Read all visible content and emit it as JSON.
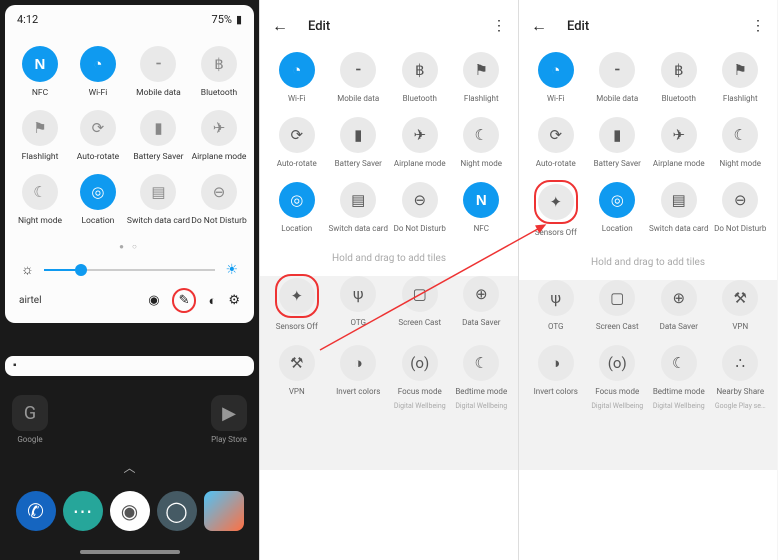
{
  "status": {
    "time": "4:12",
    "battery_pct": "75%"
  },
  "panel1": {
    "tiles": [
      {
        "label": "NFC",
        "icon": "N",
        "on": true
      },
      {
        "label": "Wi-Fi",
        "icon": "wifi",
        "on": true
      },
      {
        "label": "Mobile data",
        "icon": "signal",
        "on": false
      },
      {
        "label": "Bluetooth",
        "icon": "bt",
        "on": false
      },
      {
        "label": "Flashlight",
        "icon": "flash",
        "on": false
      },
      {
        "label": "Auto-rotate",
        "icon": "rotate",
        "on": false
      },
      {
        "label": "Battery Saver",
        "icon": "batt",
        "on": false
      },
      {
        "label": "Airplane mode",
        "icon": "plane",
        "on": false
      },
      {
        "label": "Night mode",
        "icon": "moon",
        "on": false
      },
      {
        "label": "Location",
        "icon": "loc",
        "on": true
      },
      {
        "label": "Switch data card",
        "icon": "sim",
        "on": false
      },
      {
        "label": "Do Not Disturb",
        "icon": "dnd",
        "on": false
      }
    ],
    "carrier": "airtel",
    "apps": {
      "google": "Google",
      "playstore": "Play Store"
    }
  },
  "edit_title": "Edit",
  "drag_hint": "Hold and drag to add tiles",
  "panel2": {
    "active_tiles": [
      {
        "label": "Wi-Fi",
        "icon": "wifi",
        "on": true
      },
      {
        "label": "Mobile data",
        "icon": "signal",
        "on": false
      },
      {
        "label": "Bluetooth",
        "icon": "bt",
        "on": false
      },
      {
        "label": "Flashlight",
        "icon": "flash",
        "on": false
      },
      {
        "label": "Auto-rotate",
        "icon": "rotate",
        "on": false
      },
      {
        "label": "Battery Saver",
        "icon": "batt",
        "on": false
      },
      {
        "label": "Airplane mode",
        "icon": "plane",
        "on": false
      },
      {
        "label": "Night mode",
        "icon": "moon",
        "on": false
      },
      {
        "label": "Location",
        "icon": "loc",
        "on": true
      },
      {
        "label": "Switch data card",
        "icon": "sim",
        "on": false
      },
      {
        "label": "Do Not Disturb",
        "icon": "dnd",
        "on": false
      },
      {
        "label": "NFC",
        "icon": "N",
        "on": true
      }
    ],
    "inactive_tiles": [
      {
        "label": "Sensors Off",
        "icon": "sensor",
        "mark": true
      },
      {
        "label": "OTG",
        "icon": "otg"
      },
      {
        "label": "Screen Cast",
        "icon": "cast"
      },
      {
        "label": "Data Saver",
        "icon": "ds"
      },
      {
        "label": "VPN",
        "icon": "vpn"
      },
      {
        "label": "Invert colors",
        "icon": "inv"
      },
      {
        "label": "Focus mode",
        "icon": "focus",
        "sub": "Digital Wellbeing"
      },
      {
        "label": "Bedtime mode",
        "icon": "bed",
        "sub": "Digital Wellbeing"
      }
    ]
  },
  "panel3": {
    "active_tiles": [
      {
        "label": "Wi-Fi",
        "icon": "wifi",
        "on": true
      },
      {
        "label": "Mobile data",
        "icon": "signal",
        "on": false
      },
      {
        "label": "Bluetooth",
        "icon": "bt",
        "on": false
      },
      {
        "label": "Flashlight",
        "icon": "flash",
        "on": false
      },
      {
        "label": "Auto-rotate",
        "icon": "rotate",
        "on": false
      },
      {
        "label": "Battery Saver",
        "icon": "batt",
        "on": false
      },
      {
        "label": "Airplane mode",
        "icon": "plane",
        "on": false
      },
      {
        "label": "Night mode",
        "icon": "moon",
        "on": false
      },
      {
        "label": "Sensors Off",
        "icon": "sensor",
        "on": false,
        "mark": true
      },
      {
        "label": "Location",
        "icon": "loc",
        "on": true
      },
      {
        "label": "Switch data card",
        "icon": "sim",
        "on": false
      },
      {
        "label": "Do Not Disturb",
        "icon": "dnd",
        "on": false
      }
    ],
    "inactive_tiles": [
      {
        "label": "OTG",
        "icon": "otg"
      },
      {
        "label": "Screen Cast",
        "icon": "cast"
      },
      {
        "label": "Data Saver",
        "icon": "ds"
      },
      {
        "label": "VPN",
        "icon": "vpn"
      },
      {
        "label": "Invert colors",
        "icon": "inv"
      },
      {
        "label": "Focus mode",
        "icon": "focus",
        "sub": "Digital Wellbeing"
      },
      {
        "label": "Bedtime mode",
        "icon": "bed",
        "sub": "Digital Wellbeing"
      },
      {
        "label": "Nearby Share",
        "icon": "share",
        "sub": "Google Play se…"
      }
    ]
  },
  "icons": {
    "wifi": "◔",
    "signal": "⁃",
    "bt": "฿",
    "flash": "⚑",
    "rotate": "⟳",
    "batt": "▮",
    "plane": "✈",
    "moon": "☾",
    "loc": "◎",
    "sim": "▤",
    "dnd": "⊖",
    "N": "N",
    "sensor": "✦",
    "otg": "ψ",
    "cast": "▢",
    "ds": "⊕",
    "vpn": "⚒",
    "inv": "◑",
    "focus": "(o)",
    "bed": "☾",
    "share": "∴"
  }
}
